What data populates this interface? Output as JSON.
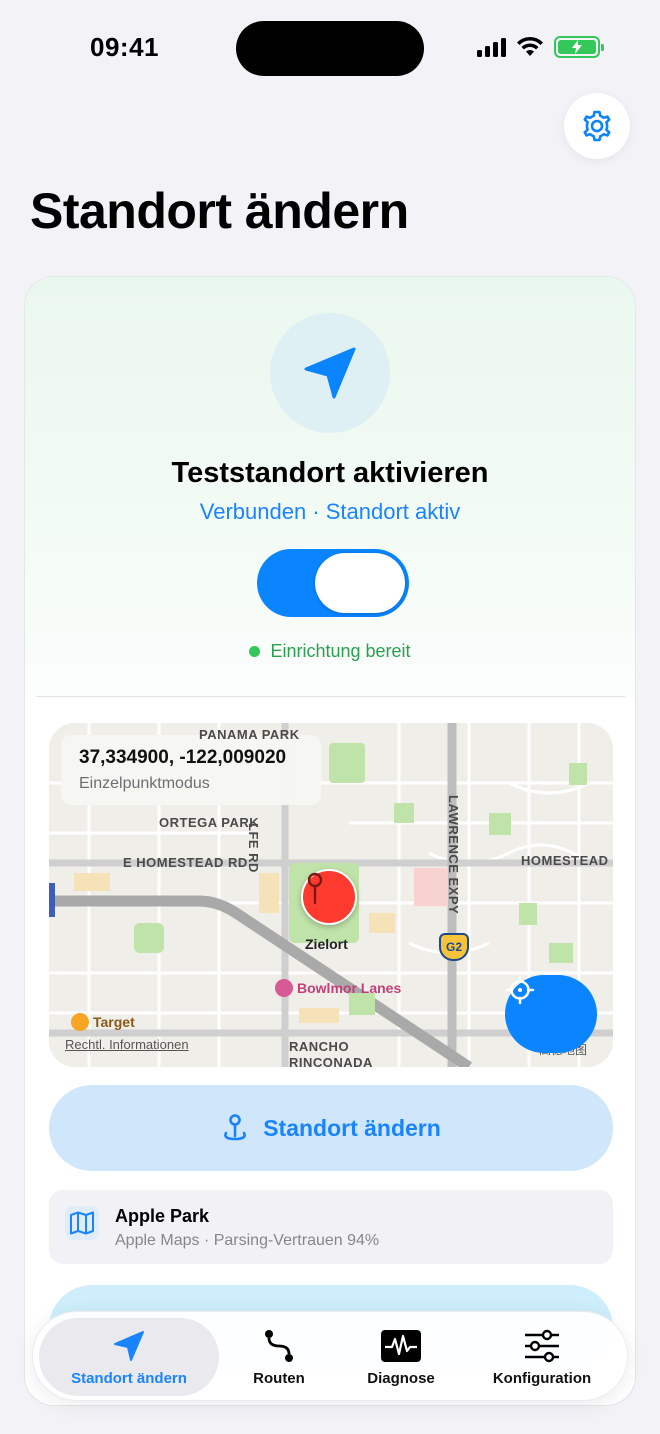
{
  "status_bar": {
    "time": "09:41"
  },
  "header": {
    "title": "Standort ändern",
    "settings_icon": "gear-icon"
  },
  "activation": {
    "icon": "location-arrow-icon",
    "title": "Teststandort aktivieren",
    "subtitle": "Verbunden · Standort aktiv",
    "toggle_on": true,
    "status_text": "Einrichtung bereit"
  },
  "map": {
    "coordinates": "37,334900, -122,009020",
    "mode": "Einzelpunktmodus",
    "pin_label": "Zielort",
    "labels": {
      "panama_park": "PANAMA PARK",
      "ortega_park": "ORTEGA PARK",
      "homestead_rd": "E HOMESTEAD RD",
      "homestead_right": "HOMESTEAD",
      "wolfe_rd": "LFE RD",
      "lawrence_expy": "LAWRENCE EXPY",
      "rancho": "RANCHO",
      "rinconada": "RINCONADA"
    },
    "highway_shield": "G2",
    "poi_bowlmor": "Bowlmor Lanes",
    "poi_target": "Target",
    "legal": "Rechtl. Informationen",
    "attribution": "高德地图"
  },
  "primary_action": {
    "label": "Standort ändern",
    "icon": "pin-icon"
  },
  "place": {
    "title": "Apple Park",
    "subtitle": "Apple Maps · Parsing-Vertrauen 94%",
    "icon": "map-icon"
  },
  "tabs": [
    {
      "label": "Standort ändern",
      "icon": "location-arrow-icon",
      "active": true
    },
    {
      "label": "Routen",
      "icon": "route-icon",
      "active": false
    },
    {
      "label": "Diagnose",
      "icon": "waveform-icon",
      "active": false
    },
    {
      "label": "Konfiguration",
      "icon": "sliders-icon",
      "active": false
    }
  ],
  "colors": {
    "accent": "#0a84ff",
    "success": "#34c759",
    "pin": "#ff3b30",
    "background": "#f2f2f7"
  }
}
